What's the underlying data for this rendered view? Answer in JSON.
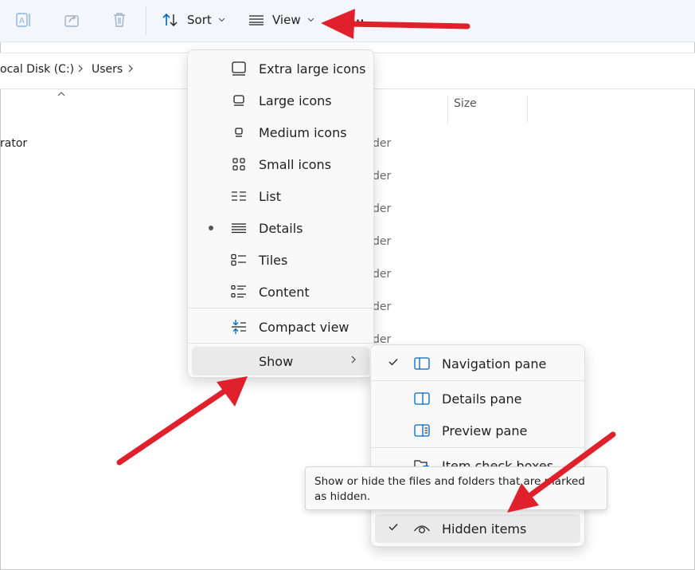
{
  "toolbar": {
    "sort_label": "Sort",
    "view_label": "View",
    "more_label": "···"
  },
  "address": {
    "crumbs": [
      "ocal Disk (C:)",
      "Users"
    ]
  },
  "content": {
    "size_header": "Size",
    "first_row_name": "rator",
    "type_fragments": [
      "der",
      "der",
      "der",
      "der",
      "der",
      "der",
      "der"
    ]
  },
  "view_menu": {
    "items": [
      {
        "label": "Extra large icons",
        "icon": "extra-large-icons-icon"
      },
      {
        "label": "Large icons",
        "icon": "large-icons-icon"
      },
      {
        "label": "Medium icons",
        "icon": "medium-icons-icon"
      },
      {
        "label": "Small icons",
        "icon": "small-icons-icon"
      },
      {
        "label": "List",
        "icon": "list-icon"
      },
      {
        "label": "Details",
        "icon": "details-icon",
        "selected": true
      },
      {
        "label": "Tiles",
        "icon": "tiles-icon"
      },
      {
        "label": "Content",
        "icon": "content-icon"
      }
    ],
    "compact_label": "Compact view",
    "show_label": "Show"
  },
  "show_menu": {
    "navigation_pane": "Navigation pane",
    "details_pane": "Details pane",
    "preview_pane": "Preview pane",
    "item_check_boxes": "Item check boxes",
    "hidden_items": "Hidden items"
  },
  "tooltip": {
    "text": "Show or hide the files and folders that are marked as hidden."
  },
  "colors": {
    "accent": "#0067c0",
    "annotation_arrow": "#e0202a",
    "toolbar_bg": "#f3f7fb",
    "menu_bg": "#f9f9f9"
  }
}
